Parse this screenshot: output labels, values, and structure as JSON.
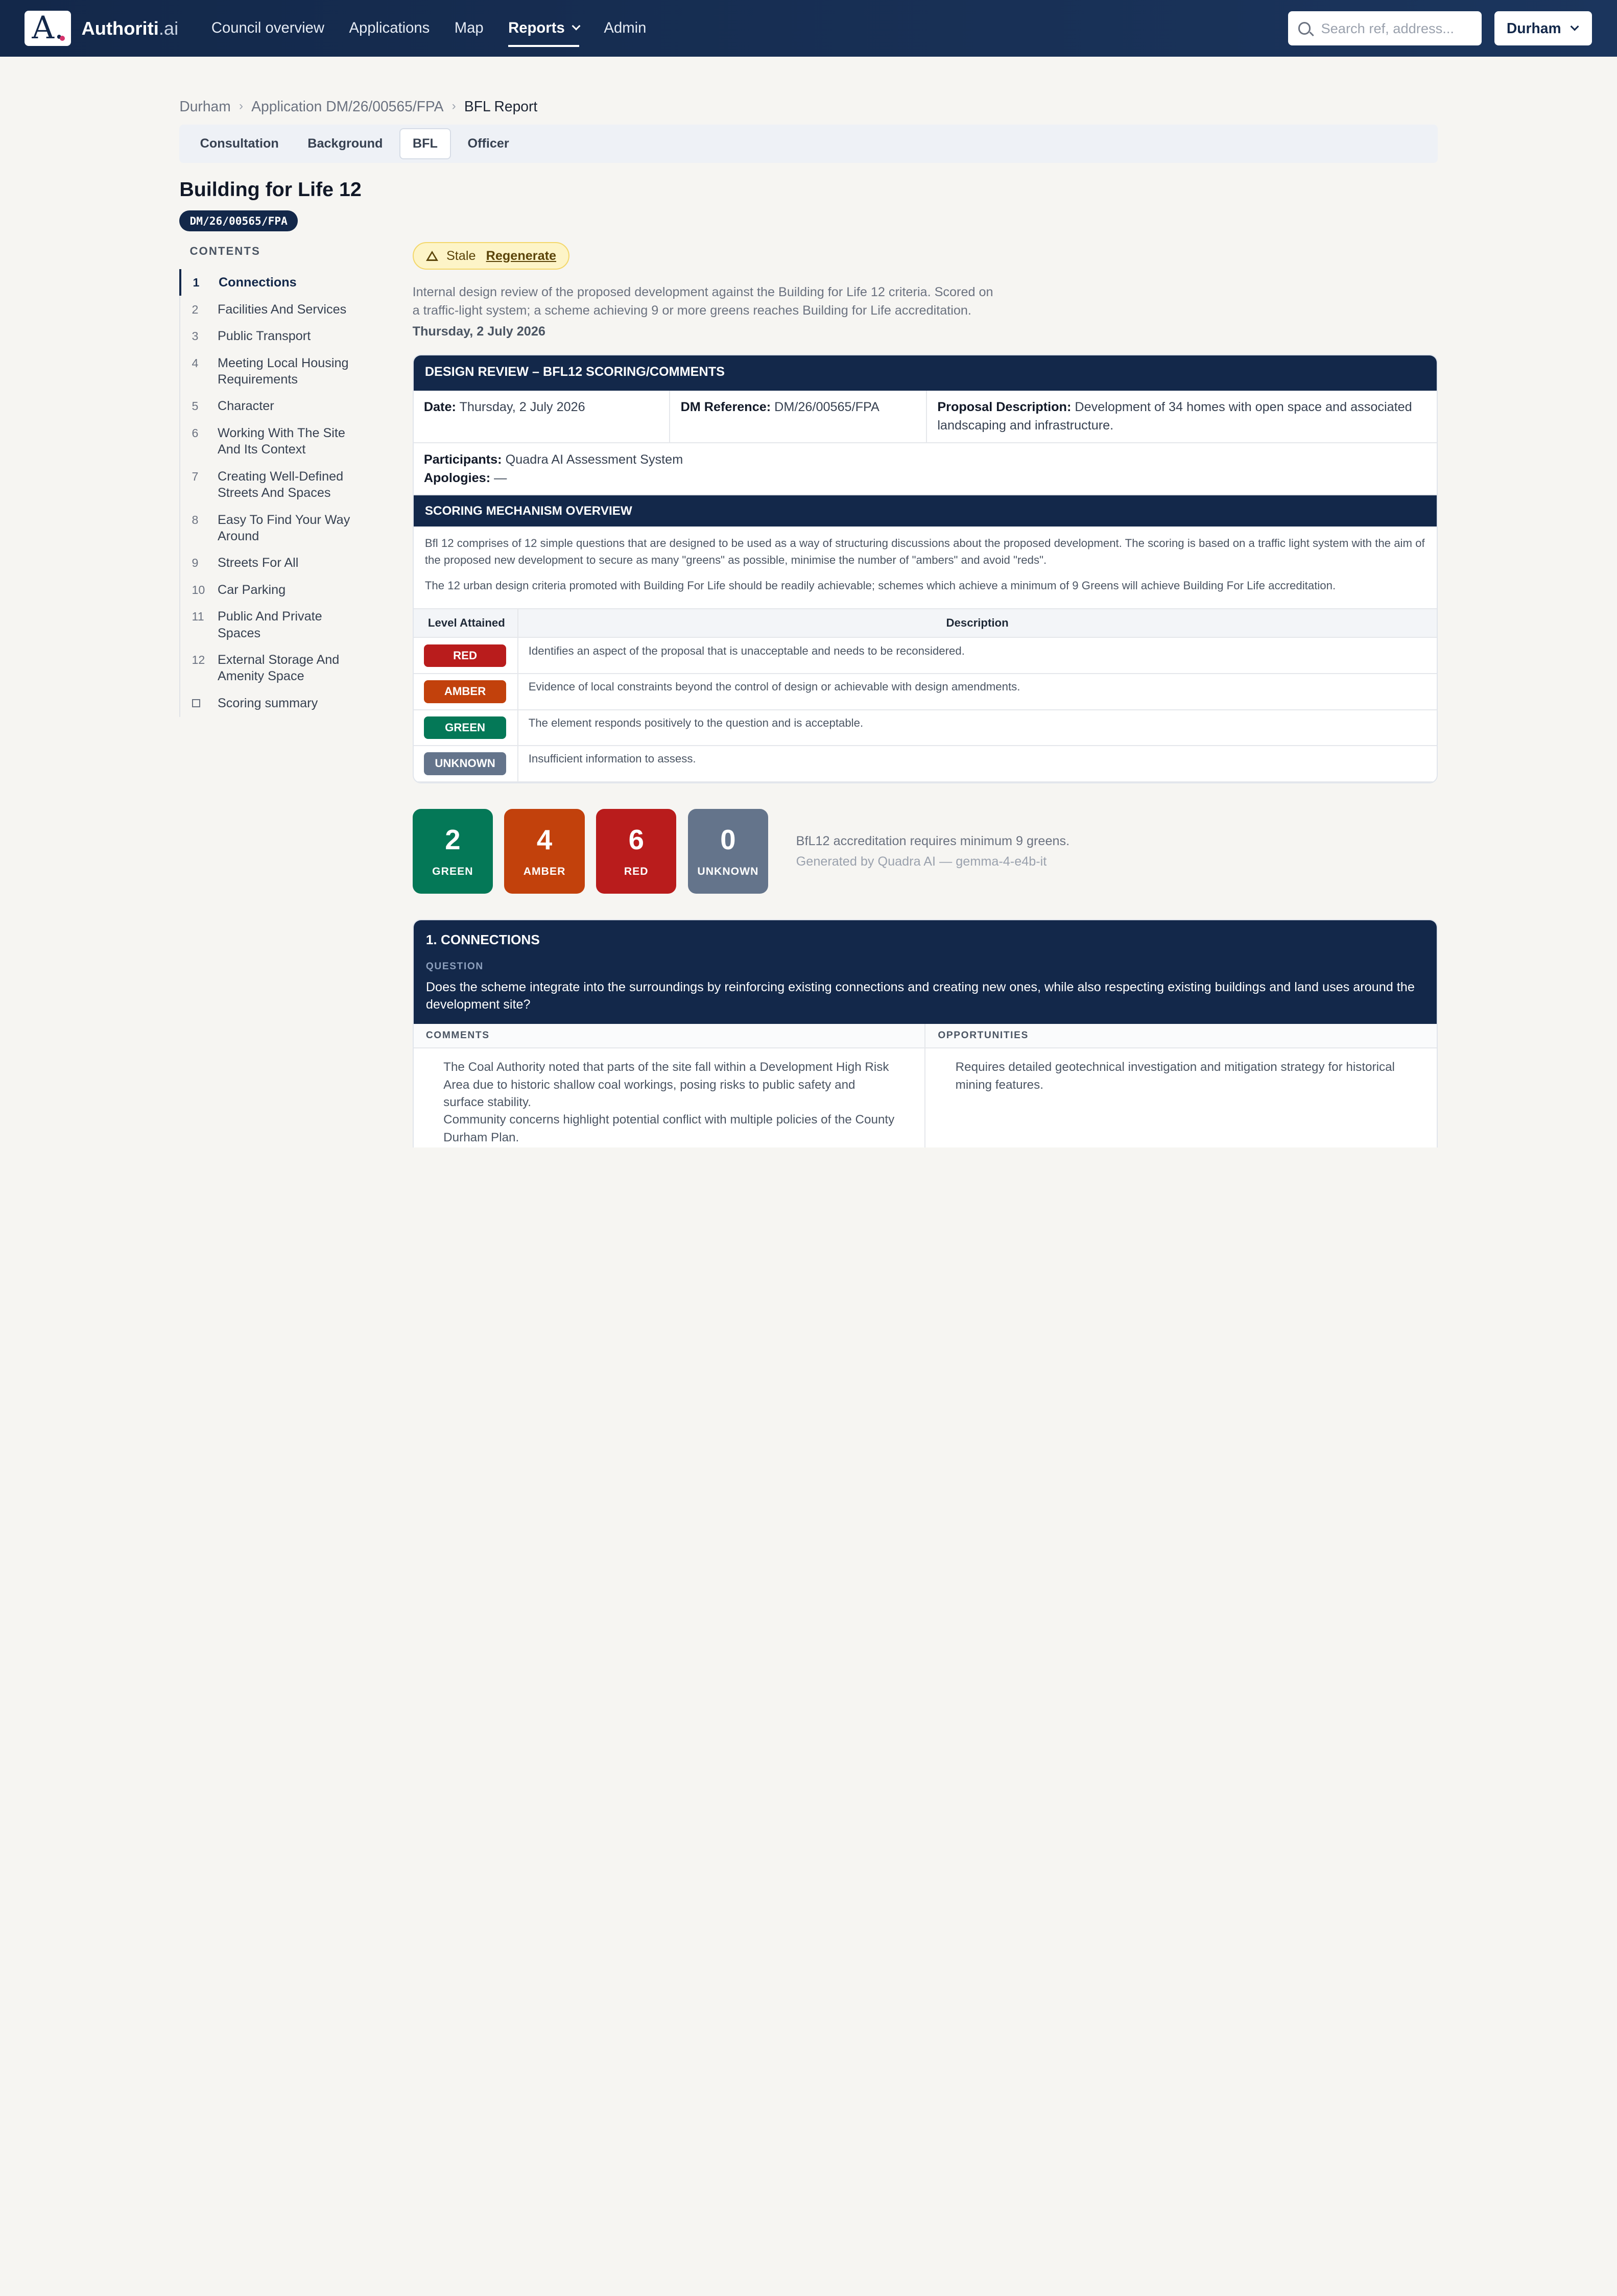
{
  "nav": {
    "logo_letter": "A.",
    "brand_name": "Authoriti",
    "brand_suffix": ".ai",
    "links": [
      "Council overview",
      "Applications",
      "Map",
      "Reports",
      "Admin"
    ],
    "search_placeholder": "Search ref, address...",
    "council": "Durham"
  },
  "breadcrumb": [
    "Durham",
    "Application DM/26/00565/FPA",
    "BFL Report"
  ],
  "tabs": [
    "Consultation",
    "Background",
    "BFL",
    "Officer"
  ],
  "sidebar": {
    "title": "Building for Life 12",
    "ref": "DM/26/00565/FPA",
    "contents_heading": "CONTENTS",
    "items": [
      {
        "n": "1",
        "label": "Connections"
      },
      {
        "n": "2",
        "label": "Facilities And Services"
      },
      {
        "n": "3",
        "label": "Public Transport"
      },
      {
        "n": "4",
        "label": "Meeting Local Housing Requirements"
      },
      {
        "n": "5",
        "label": "Character"
      },
      {
        "n": "6",
        "label": "Working With The Site And Its Context"
      },
      {
        "n": "7",
        "label": "Creating Well-Defined Streets And Spaces"
      },
      {
        "n": "8",
        "label": "Easy To Find Your Way Around"
      },
      {
        "n": "9",
        "label": "Streets For All"
      },
      {
        "n": "10",
        "label": "Car Parking"
      },
      {
        "n": "11",
        "label": "Public And Private Spaces"
      },
      {
        "n": "12",
        "label": "External Storage And Amenity Space"
      },
      {
        "n": "",
        "label": "Scoring summary"
      }
    ]
  },
  "status": {
    "stale": "Stale",
    "regenerate": "Regenerate"
  },
  "intro": {
    "text": "Internal design review of the proposed development against the Building for Life 12 criteria. Scored on a traffic-light system; a scheme achieving 9 or more greens reaches Building for Life accreditation.",
    "date": "Thursday, 2 July 2026"
  },
  "review": {
    "heading": "DESIGN REVIEW – BFL12 SCORING/COMMENTS",
    "date_label": "Date:",
    "date_value": "Thursday, 2 July 2026",
    "ref_label": "DM Reference:",
    "ref_value": "DM/26/00565/FPA",
    "proposal_label": "Proposal Description:",
    "proposal_value": "Development of 34 homes with open space and associated landscaping and infrastructure.",
    "participants_label": "Participants:",
    "participants_value": "Quadra AI Assessment System",
    "apologies_label": "Apologies:",
    "apologies_value": "—",
    "mech_heading": "SCORING MECHANISM OVERVIEW",
    "mech_p1": "Bfl 12 comprises of 12 simple questions that are designed to be used as a way of structuring discussions about the proposed development. The scoring is based on a traffic light system with the aim of the proposed new development to secure as many \"greens\" as possible, minimise the number of \"ambers\" and avoid \"reds\".",
    "mech_p2": "The 12 urban design criteria promoted with Building For Life should be readily achievable; schemes which achieve a minimum of 9 Greens will achieve Building For Life accreditation.",
    "col_level": "Level Attained",
    "col_desc": "Description",
    "levels": [
      {
        "label": "RED",
        "color": "#b91c1c",
        "desc": "Identifies an aspect of the proposal that is unacceptable and needs to be reconsidered."
      },
      {
        "label": "AMBER",
        "color": "#c2410c",
        "desc": "Evidence of local constraints beyond the control of design or achievable with design amendments."
      },
      {
        "label": "GREEN",
        "color": "#047857",
        "desc": "The element responds positively to the question and is acceptable."
      },
      {
        "label": "UNKNOWN",
        "color": "#64748b",
        "desc": "Insufficient information to assess."
      }
    ]
  },
  "scores": [
    {
      "num": "2",
      "label": "GREEN",
      "color": "#047857"
    },
    {
      "num": "4",
      "label": "AMBER",
      "color": "#c2410c"
    },
    {
      "num": "6",
      "label": "RED",
      "color": "#b91c1c"
    },
    {
      "num": "0",
      "label": "UNKNOWN",
      "color": "#64748b"
    }
  ],
  "score_note": "BfL12 accreditation requires minimum 9 greens.",
  "score_gen": "Generated by Quadra AI — gemma-4-e4b-it",
  "section1": {
    "title": "1. CONNECTIONS",
    "question_label": "QUESTION",
    "question": "Does the scheme integrate into the surroundings by reinforcing existing connections and creating new ones, while also respecting existing buildings and land uses around the development site?",
    "comments_label": "COMMENTS",
    "opportunities_label": "OPPORTUNITIES",
    "comment1": "The Coal Authority noted that parts of the site fall within a Development High Risk Area due to historic shallow coal workings, posing risks to public safety and surface stability.",
    "comment2": "Community concerns highlight potential conflict with multiple policies of the County Durham Plan.",
    "opportunity1": "Requires detailed geotechnical investigation and mitigation strategy for historical mining features."
  }
}
